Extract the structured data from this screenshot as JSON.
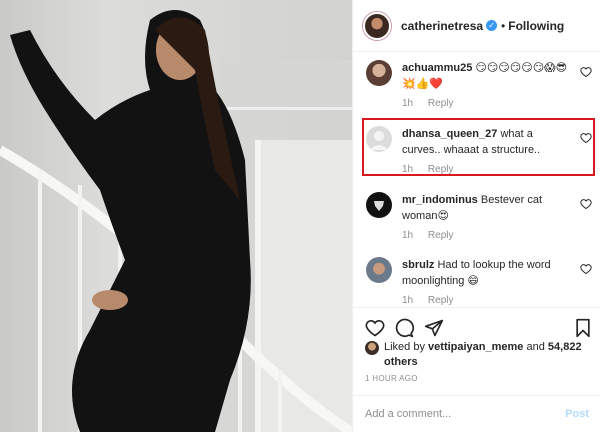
{
  "header": {
    "username": "catherinetresa",
    "separator": "•",
    "follow_status": "Following"
  },
  "comments": [
    {
      "user": "achuammu25",
      "text": "😏😏😏😏😏😏😱😎💥👍❤️",
      "age": "1h",
      "reply": "Reply"
    },
    {
      "user": "dhansa_queen_27",
      "text": "what a curves.. whaaat a structure..",
      "age": "1h",
      "reply": "Reply"
    },
    {
      "user": "mr_indominus",
      "text": "Bestever cat woman😍",
      "age": "1h",
      "reply": "Reply"
    },
    {
      "user": "sbrulz",
      "text": "Had to lookup the word moonlighting 😄",
      "age": "1h",
      "reply": "Reply"
    }
  ],
  "likes": {
    "prefix": "Liked by",
    "liker": "vettipaiyan_meme",
    "and": "and",
    "count": "54,822 others"
  },
  "time_ago": "1 HOUR AGO",
  "add_comment": {
    "placeholder": "Add a comment...",
    "post_label": "Post"
  },
  "colors": {
    "highlight": "#d9181f",
    "verified": "#3897f0",
    "muted": "#8e8e8e",
    "post_disabled": "#b3dbff"
  },
  "icons": [
    "verified-badge-icon",
    "heart-icon",
    "comment-icon",
    "share-icon",
    "bookmark-icon"
  ]
}
